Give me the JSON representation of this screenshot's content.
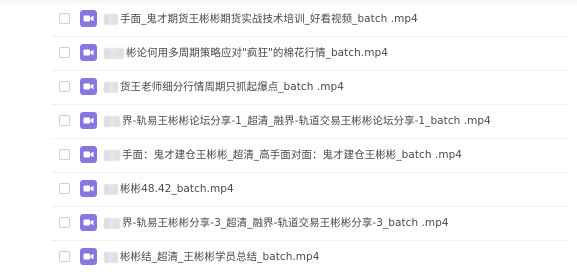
{
  "file_list": {
    "icon_color": "#8677e0",
    "icon_name": "video-file-icon",
    "items": [
      {
        "prefix_redacted": true,
        "name": "手面_鬼才期货王彬彬期货实战技术培训_好看视频_batch .mp4"
      },
      {
        "prefix_redacted": true,
        "name": "彬论何用多周期策略应对\"疯狂\"的棉花行情_batch.mp4"
      },
      {
        "prefix_redacted": true,
        "name": "货王老师细分行情周期只抓起爆点_batch .mp4"
      },
      {
        "prefix_redacted": true,
        "name": "界-轨易王彬彬论坛分享-1_超清_融界-轨道交易王彬彬论坛分享-1_batch .mp4"
      },
      {
        "prefix_redacted": true,
        "name": "手面：鬼才建仓王彬彬_超清_高手面对面：鬼才建仓王彬彬_batch .mp4"
      },
      {
        "prefix_redacted": true,
        "name": "彬彬48.42_batch.mp4"
      },
      {
        "prefix_redacted": true,
        "name": "界-轨易王彬彬分享-3_超清_融界-轨道交易王彬彬分享-3_batch .mp4"
      },
      {
        "prefix_redacted": true,
        "name": "彬彬结_超清_王彬彬学员总结_batch.mp4"
      }
    ]
  }
}
